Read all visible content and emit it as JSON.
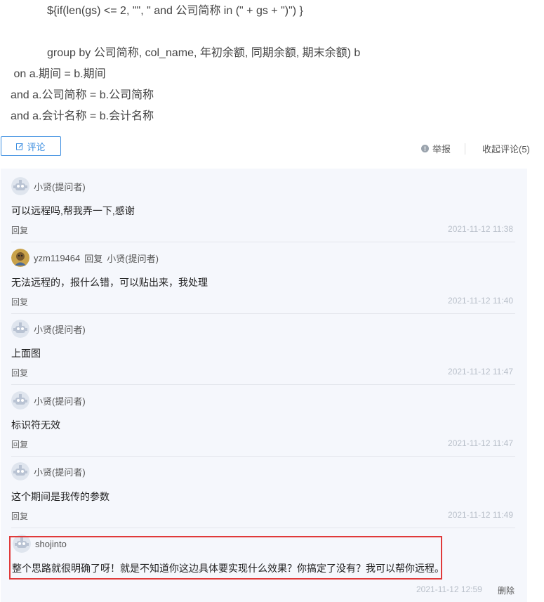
{
  "code_lines": [
    "${if(len(gs) <= 2, \"\", \" and 公司简称 in (\" + gs + \")\") }",
    "group by 公司简称, col_name, 年初余额, 同期余额, 期末余额) b",
    " on a.期间 = b.期间",
    "and a.公司简称 = b.公司简称",
    "and a.会计名称 = b.会计名称"
  ],
  "toolbar": {
    "comment_label": "评论",
    "report_label": "举报",
    "collapse_label": "收起评论(5)"
  },
  "comments": [
    {
      "author": "小贤(提问者)",
      "reply_to": "",
      "body": "可以远程吗,帮我弄一下,感谢",
      "reply_label": "回复",
      "time": "2021-11-12 11:38"
    },
    {
      "author": "yzm119464",
      "reply_word": "回复",
      "reply_to": "小贤(提问者)",
      "body": "无法远程的，报什么错，可以贴出来，我处理",
      "reply_label": "回复",
      "time": "2021-11-12 11:40"
    },
    {
      "author": "小贤(提问者)",
      "reply_to": "",
      "body": "上面图",
      "reply_label": "回复",
      "time": "2021-11-12 11:47"
    },
    {
      "author": "小贤(提问者)",
      "reply_to": "",
      "body": "标识符无效",
      "reply_label": "回复",
      "time": "2021-11-12 11:47"
    },
    {
      "author": "小贤(提问者)",
      "reply_to": "",
      "body": "这个期间是我传的参数",
      "reply_label": "回复",
      "time": "2021-11-12 11:49"
    },
    {
      "author": "shojinto",
      "reply_to": "",
      "body": "整个思路就很明确了呀！就是不知道你这边具体要实现什么效果？你搞定了没有？我可以帮你远程。",
      "time": "2021-11-12 12:59",
      "delete_label": "删除"
    }
  ],
  "colors": {
    "accent": "#3b8de0",
    "highlight": "#e03a3a",
    "panel_bg": "#f5f7fc"
  }
}
